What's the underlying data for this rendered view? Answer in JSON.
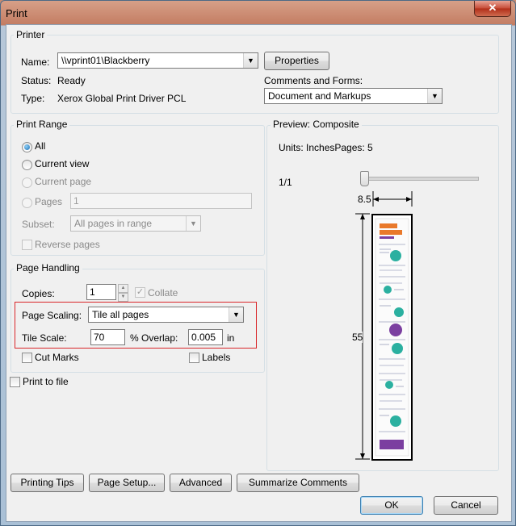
{
  "window": {
    "title": "Print",
    "close_glyph": "✕"
  },
  "printer": {
    "group_label": "Printer",
    "name_label": "Name:",
    "name_value": "\\\\vprint01\\Blackberry",
    "properties_label": "Properties",
    "status_label": "Status:",
    "status_value": "Ready",
    "type_label": "Type:",
    "type_value": "Xerox Global Print Driver PCL",
    "comments_label": "Comments and Forms:",
    "comments_value": "Document and Markups"
  },
  "print_range": {
    "group_label": "Print Range",
    "all_label": "All",
    "current_view_label": "Current view",
    "current_page_label": "Current page",
    "pages_label": "Pages",
    "pages_value": "1",
    "subset_label": "Subset:",
    "subset_value": "All pages in range",
    "reverse_label": "Reverse pages"
  },
  "page_handling": {
    "group_label": "Page Handling",
    "copies_label": "Copies:",
    "copies_value": "1",
    "collate_label": "Collate",
    "scaling_label": "Page Scaling:",
    "scaling_value": "Tile all pages",
    "tile_scale_label": "Tile Scale:",
    "tile_scale_value": "70",
    "percent_label": "%",
    "overlap_label": "Overlap:",
    "overlap_value": "0.005",
    "overlap_unit": "in",
    "cut_marks_label": "Cut Marks",
    "labels_label": "Labels"
  },
  "print_to_file_label": "Print to file",
  "preview": {
    "group_label": "Preview: Composite",
    "units_text": "Units: InchesPages: 5",
    "page_counter": "1/1",
    "width_label": "8.5",
    "height_label": "55",
    "slider_fraction": 0
  },
  "footer": {
    "printing_tips": "Printing Tips",
    "page_setup": "Page Setup...",
    "advanced": "Advanced",
    "summarize": "Summarize Comments",
    "ok": "OK",
    "cancel": "Cancel"
  },
  "colors": {
    "highlight_box": "#d9262a",
    "accent_teal": "#2bb0a0",
    "accent_orange": "#e9792b",
    "accent_purple": "#7b3fa0"
  }
}
